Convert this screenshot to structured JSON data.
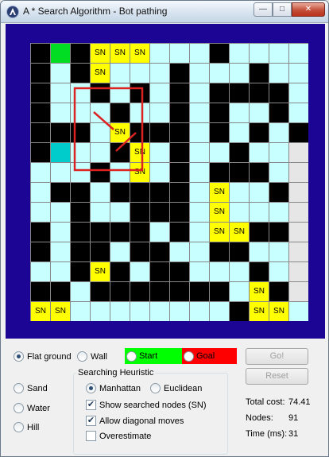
{
  "window": {
    "title": "A * Search Algorithm - Bot pathing",
    "min_glyph": "—",
    "max_glyph": "□",
    "close_glyph": "✕"
  },
  "grid": {
    "cols": 14,
    "rows": 14,
    "legend": {
      "W": "wall",
      "C": "open",
      "G": "grey",
      "S": "start",
      "T": "goal",
      "N": "searched-node"
    },
    "rows_map": [
      "WSWNNNCCCWCCC",
      "WCWNCCCWCCCWCC",
      "WCCWCWCWCWWWWC",
      "WCCCWCCWCWCCWC",
      "WWWCNWWWCWCWCW",
      "WTCCWNCWCCWCCG",
      "CCCWCNCWCWWWCG",
      "CWWCWWWWCNCCWG",
      "CCWCCWWWCNCCCG",
      "WCWWWWCWCNNWWG",
      "WCWWCWWCCWWCCG",
      "CCWNWCWWCCCWCG",
      "WWCWWWWWWWCNWG",
      "NNCCCCCCCCWNNC"
    ],
    "searched_label": "SN",
    "colors": {
      "wall": "#000000",
      "open": "#c8ffff",
      "grey": "#e6e6e6",
      "start": "#00dd22",
      "goal": "#00cccc",
      "searched": "#ffff00",
      "path": "#dd2222"
    }
  },
  "controls": {
    "terrain": {
      "flat_ground": "Flat ground",
      "wall": "Wall",
      "sand": "Sand",
      "water": "Water",
      "hill": "Hill",
      "selected": "flat_ground"
    },
    "start_label": "Start",
    "goal_label": "Goal",
    "start_color": "#00ff00",
    "goal_color": "#ff0000",
    "go_label": "Go!",
    "reset_label": "Reset",
    "heuristic": {
      "title": "Searching Heuristic",
      "manhattan": "Manhattan",
      "euclidean": "Euclidean",
      "selected": "manhattan"
    },
    "options": {
      "show_searched": {
        "label": "Show searched nodes (SN)",
        "checked": true
      },
      "allow_diagonal": {
        "label": "Allow diagonal moves",
        "checked": true
      },
      "overestimate": {
        "label": "Overestimate",
        "checked": false
      }
    },
    "stats": {
      "total_cost_label": "Total cost:",
      "total_cost": "74.41",
      "nodes_label": "Nodes:",
      "nodes": "91",
      "time_label": "Time (ms):",
      "time": "31"
    }
  }
}
